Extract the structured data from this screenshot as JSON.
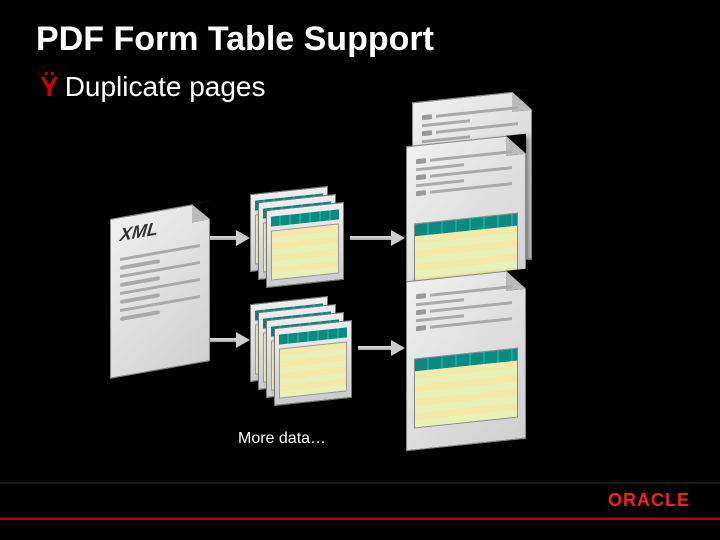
{
  "title": "PDF Form Table Support",
  "bullet": {
    "marker": "Ÿ",
    "text": "Duplicate pages"
  },
  "diagram": {
    "source_label": "XML",
    "caption": "More data…"
  },
  "branding": {
    "name": "ORACLE"
  },
  "colors": {
    "accent": "#e22",
    "table_header": "#0b8a82",
    "table_row": "#f3e9a8"
  }
}
